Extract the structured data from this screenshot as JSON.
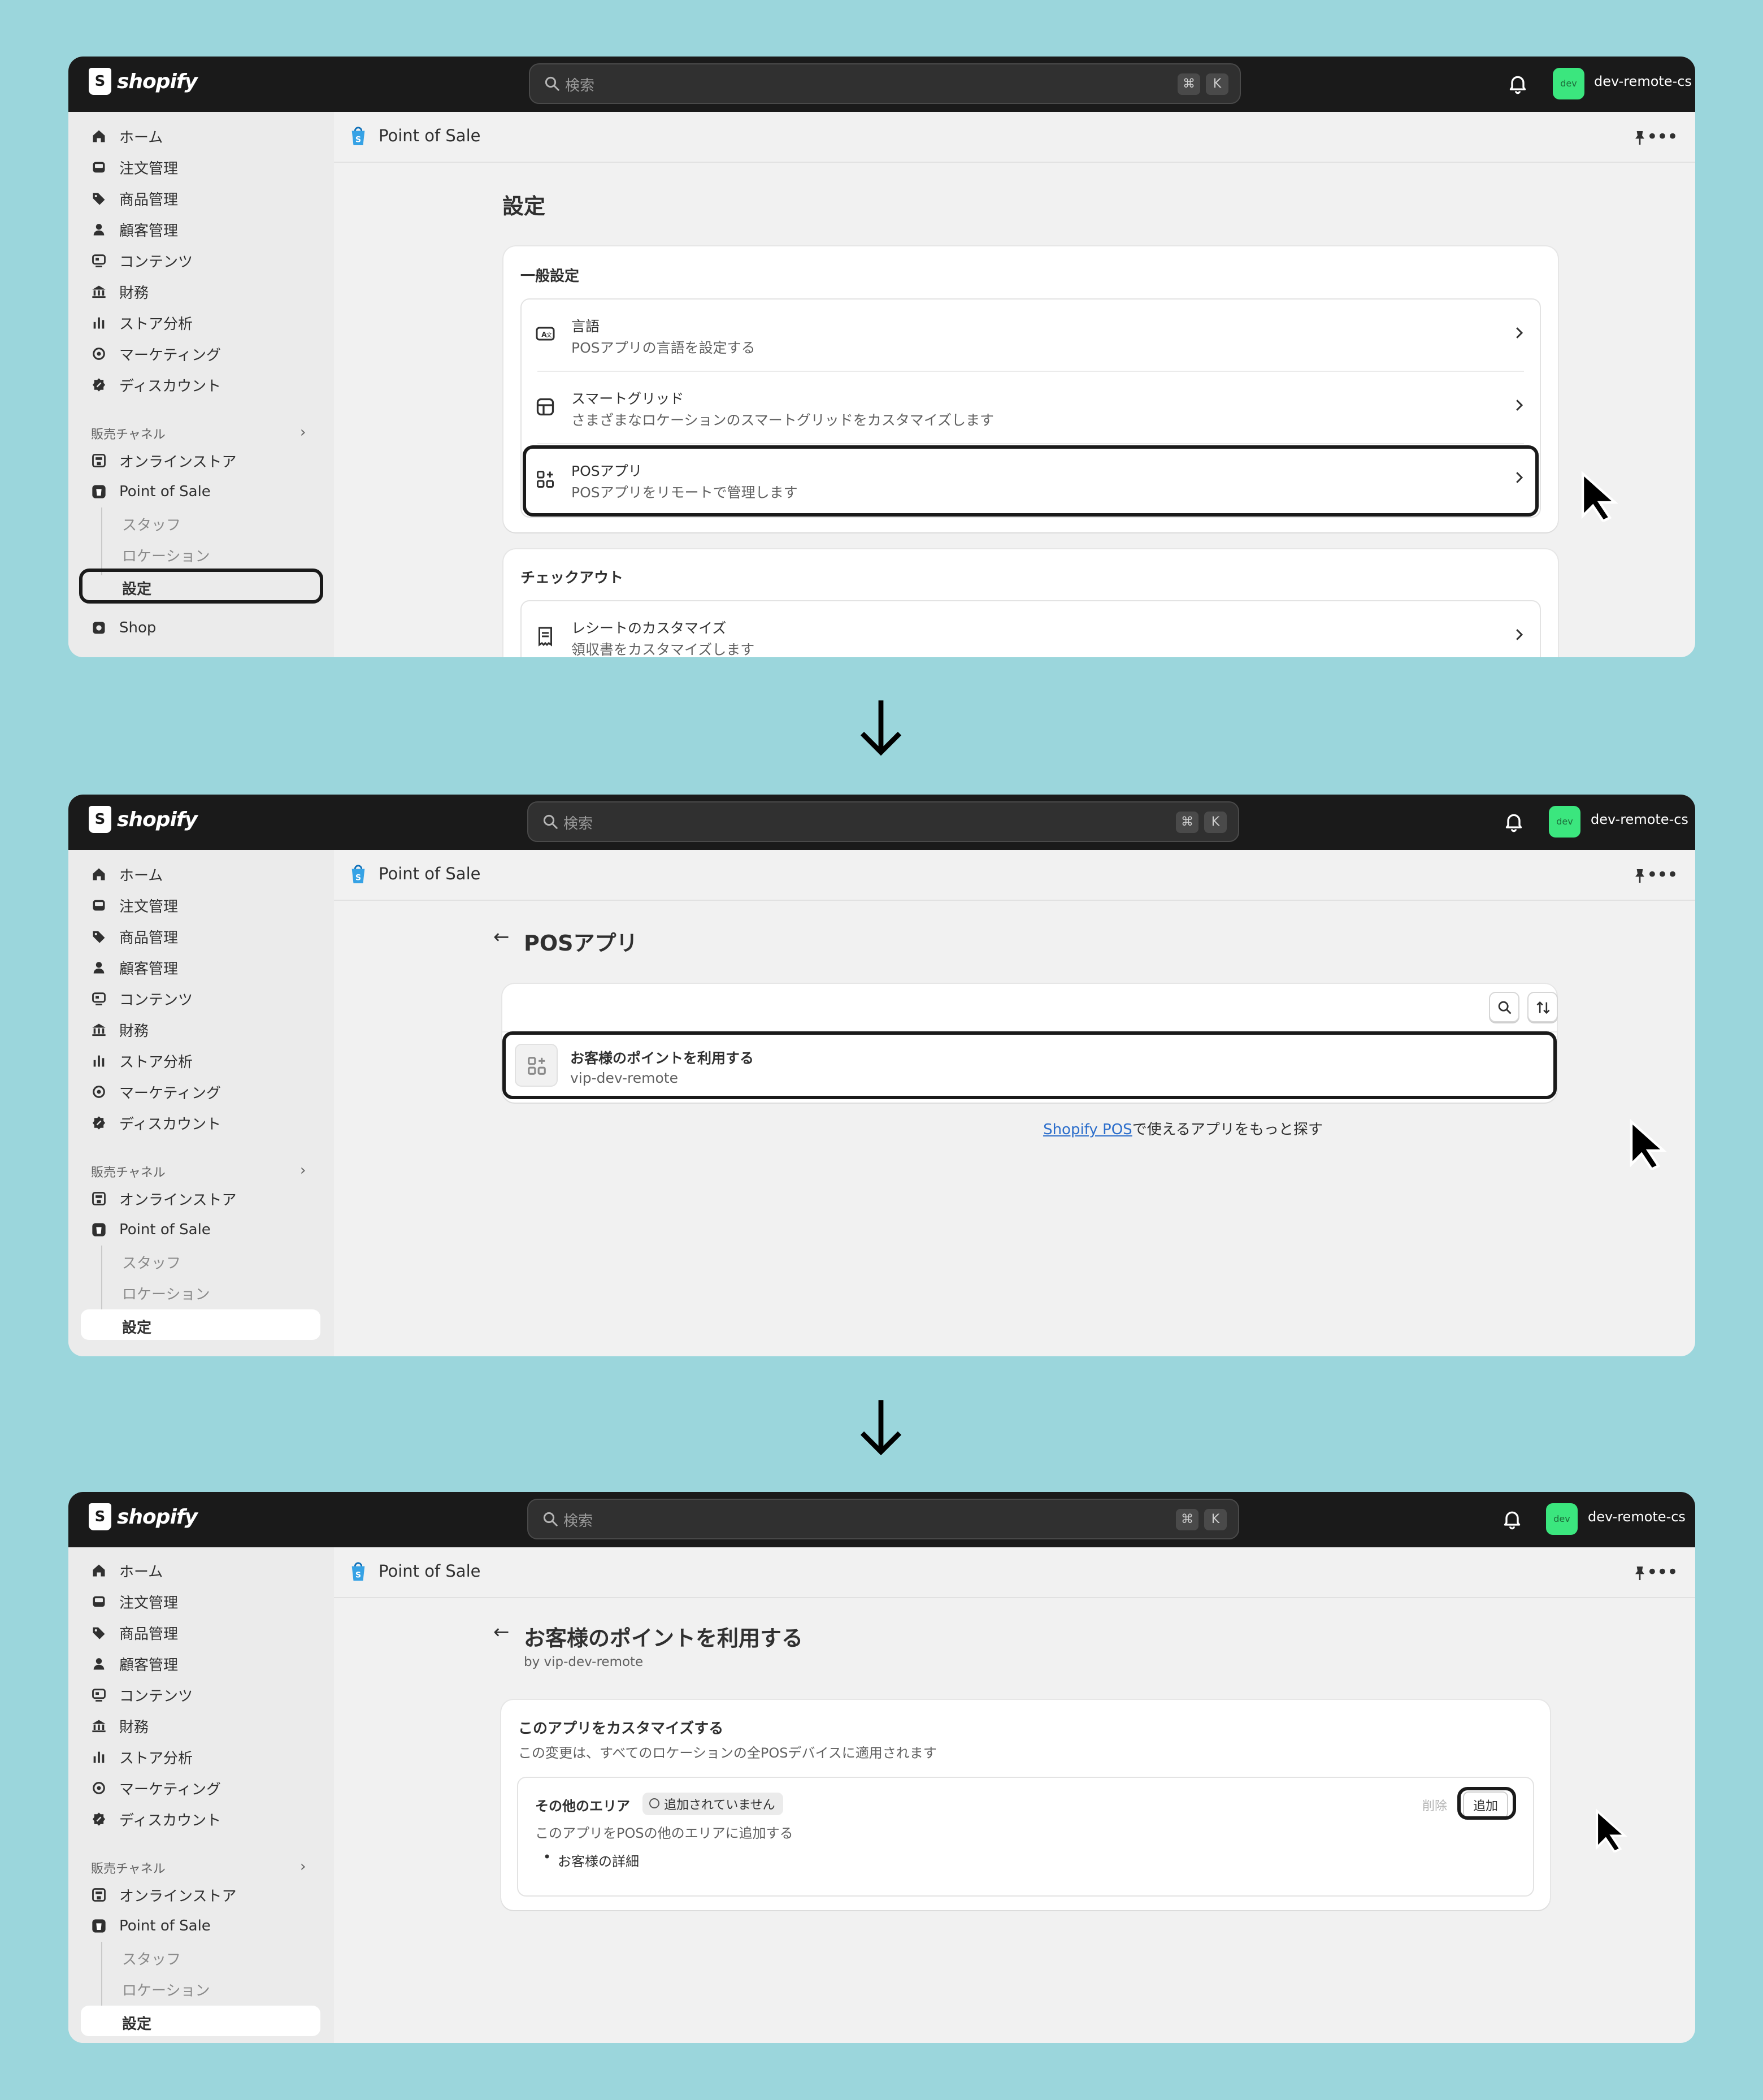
{
  "topbar": {
    "brand": "shopify",
    "search_placeholder": "検索",
    "kbd_cmd": "⌘",
    "kbd_k": "K",
    "avatar_text": "dev",
    "store_name": "dev-remote-cs"
  },
  "sidebar": {
    "items": [
      {
        "label": "ホーム",
        "icon": "home-icon"
      },
      {
        "label": "注文管理",
        "icon": "inbox-icon"
      },
      {
        "label": "商品管理",
        "icon": "tag-icon"
      },
      {
        "label": "顧客管理",
        "icon": "person-icon"
      },
      {
        "label": "コンテンツ",
        "icon": "content-icon"
      },
      {
        "label": "財務",
        "icon": "bank-icon"
      },
      {
        "label": "ストア分析",
        "icon": "bar-chart-icon"
      },
      {
        "label": "マーケティング",
        "icon": "target-icon"
      },
      {
        "label": "ディスカウント",
        "icon": "discount-icon"
      }
    ],
    "section_label": "販売チャネル",
    "online_store": "オンラインストア",
    "pos": "Point of Sale",
    "pos_sub": [
      "スタッフ",
      "ロケーション",
      "設定"
    ],
    "shop": "Shop"
  },
  "appbar": {
    "title": "Point of Sale"
  },
  "screen1": {
    "title": "設定",
    "general_title": "一般設定",
    "rows": [
      {
        "title": "言語",
        "sub": "POSアプリの言語を設定する"
      },
      {
        "title": "スマートグリッド",
        "sub": "さまざまなロケーションのスマートグリッドをカスタマイズします"
      },
      {
        "title": "POSアプリ",
        "sub": "POSアプリをリモートで管理します"
      }
    ],
    "checkout_title": "チェックアウト",
    "checkout_row": {
      "title": "レシートのカスタマイズ",
      "sub": "領収書をカスタマイズします"
    }
  },
  "screen2": {
    "title": "POSアプリ",
    "app_title": "お客様のポイントを利用する",
    "app_sub": "vip-dev-remote",
    "link_text": "Shopify POS",
    "footer_text": "で使えるアプリをもっと探す"
  },
  "screen3": {
    "title": "お客様のポイントを利用する",
    "by": "by vip-dev-remote",
    "card_title": "このアプリをカスタマイズする",
    "card_sub": "この変更は、すべてのロケーションの全POSデバイスに適用されます",
    "area_title": "その他のエリア",
    "badge": "追加されていません",
    "area_sub": "このアプリをPOSの他のエリアに追加する",
    "bullet": "お客様の詳細",
    "delete_label": "削除",
    "add_label": "追加"
  }
}
